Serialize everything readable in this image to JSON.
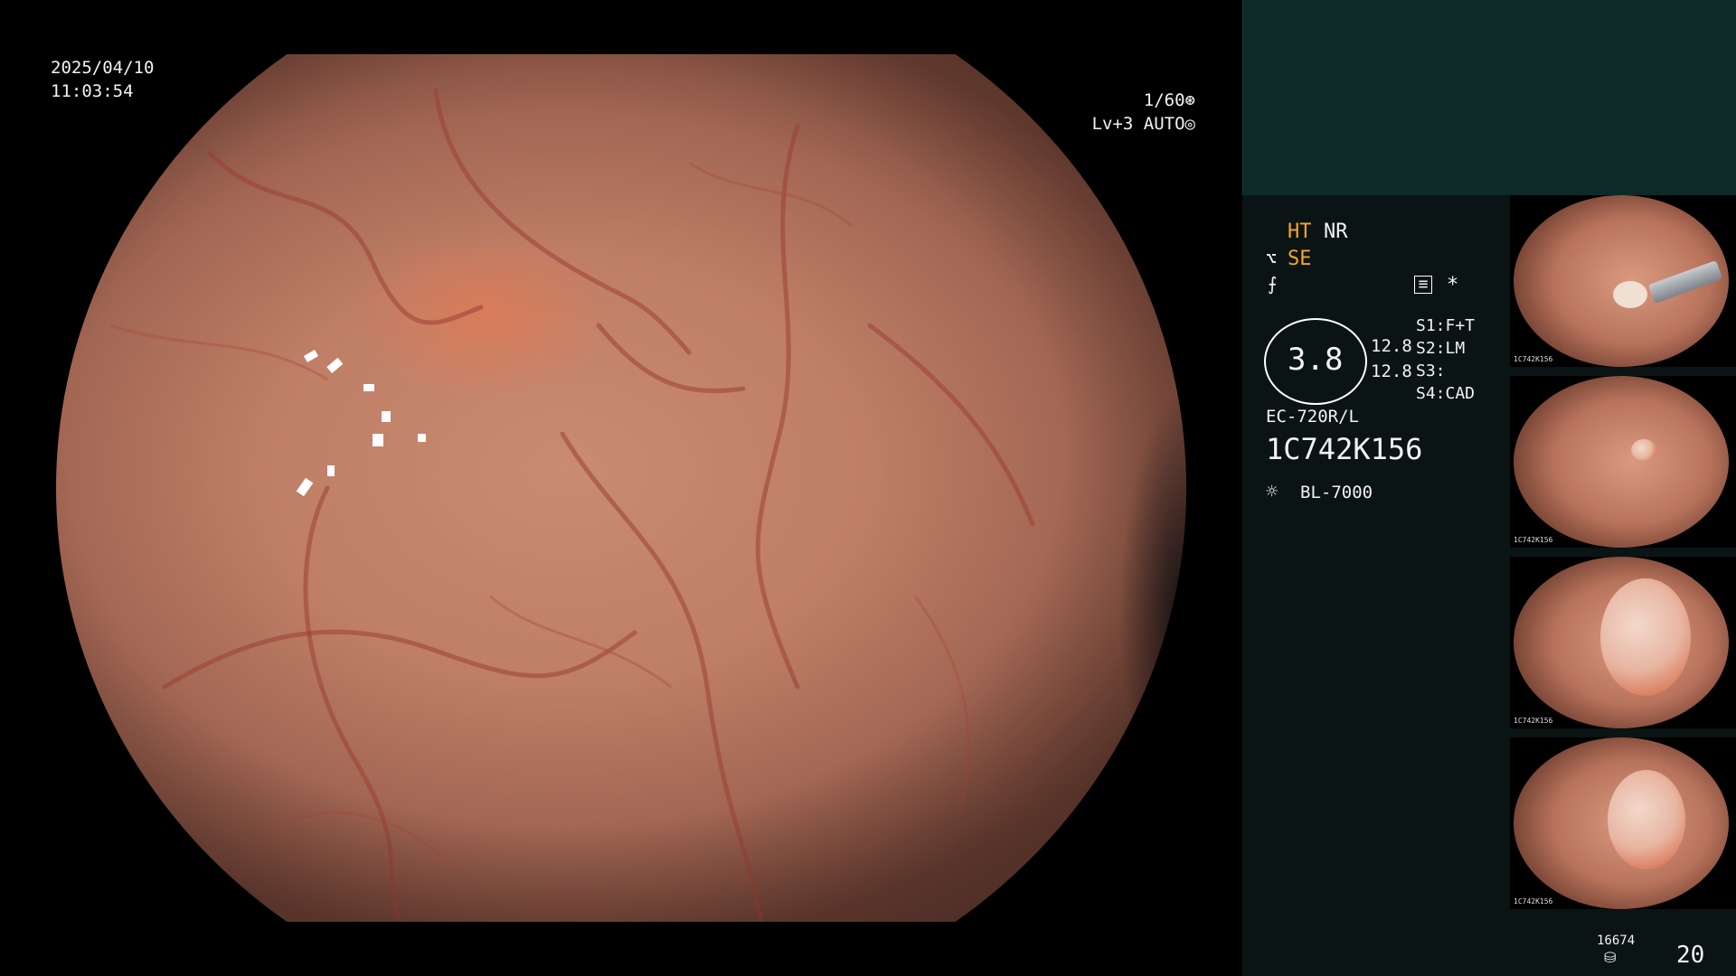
{
  "overlay": {
    "date": "2025/04/10",
    "time": "11:03:54",
    "shutter": "1/60",
    "level": "Lv+3 AUTO"
  },
  "panel": {
    "ht": "HT",
    "nr": "NR",
    "se": "SE",
    "star": "*",
    "zoom": "3.8",
    "val1": "12.8",
    "val2": "12.8",
    "s1": "S1:F+T",
    "s2": "S2:LM",
    "s3": "S3:",
    "s4": "S4:CAD",
    "model": "EC-720R/L",
    "serial": "1C742K156",
    "light": "BL-7000",
    "counter_small": "16674",
    "counter": "20"
  },
  "thumbnails": [
    {
      "tag": "1C742K156"
    },
    {
      "tag": "1C742K156"
    },
    {
      "tag": "1C742K156"
    },
    {
      "tag": "1C742K156"
    }
  ],
  "colors": {
    "accent": "#f5a623",
    "panel_top": "#0d2a28",
    "panel_bg": "#0b1414"
  },
  "icons": [
    "shutter-icon",
    "auto-iris-icon",
    "structure-icon",
    "color-icon",
    "menu-icon",
    "lamp-icon",
    "storage-icon"
  ]
}
